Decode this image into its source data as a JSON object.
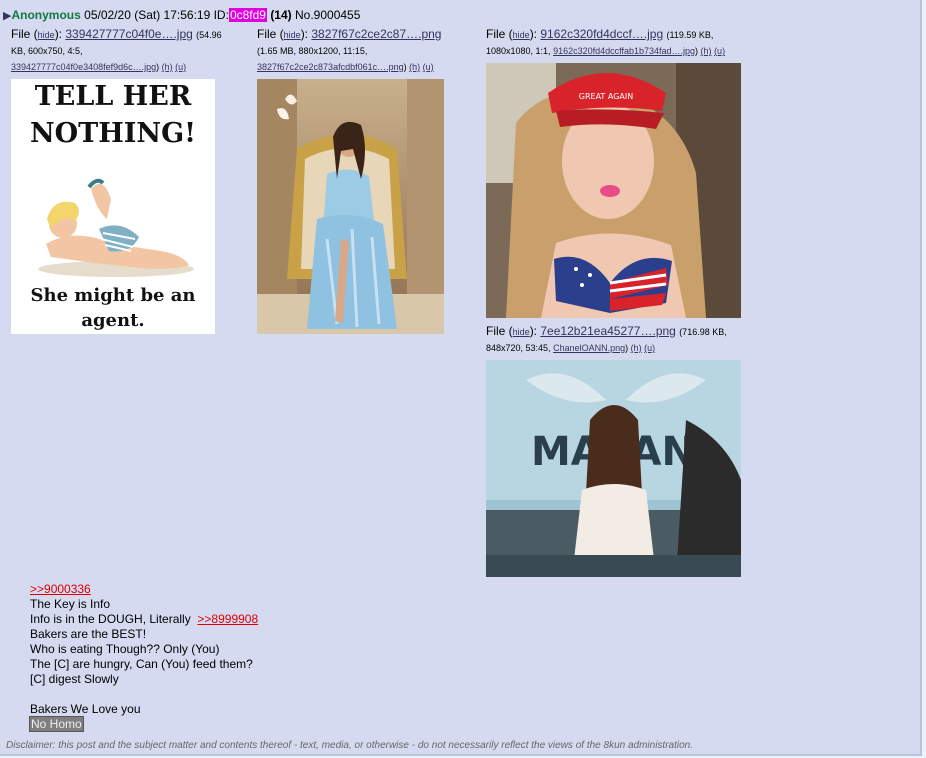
{
  "post": {
    "name": "Anonymous",
    "datetime": "05/02/20 (Sat) 17:56:19",
    "id_label": "ID:",
    "id": "0c8fd9",
    "id_count": "(14)",
    "number": "No.9000455"
  },
  "files": [
    {
      "prefix": "File (",
      "hide": "hide",
      "suffix": "):",
      "filename": "339427777c04f0e….jpg",
      "meta1": "(54.96",
      "meta2": "KB, 600x750, 4:5,",
      "original": "339427777c04f0e3408fef9d6c….jpg",
      "h": "(h)",
      "u": "(u)"
    },
    {
      "prefix": "File (",
      "hide": "hide",
      "suffix": "):",
      "filename": "3827f67c2ce2c87….png",
      "meta1": "",
      "meta2": "(1.65 MB, 880x1200, 11:15,",
      "original": "3827f67c2ce2c873afcdbf061c….png",
      "h": "(h)",
      "u": "(u)"
    },
    {
      "prefix": "File (",
      "hide": "hide",
      "suffix": "):",
      "filename": "9162c320fd4dccf….jpg",
      "meta1": "(119.59 KB,",
      "meta2": "1080x1080, 1:1,",
      "original": "9162c320fd4dccffab1b734fad….jpg",
      "h": "(h)",
      "u": "(u)"
    },
    {
      "prefix": "File (",
      "hide": "hide",
      "suffix": "):",
      "filename": "7ee12b21ea45277….png",
      "meta1": "(716.98 KB,",
      "meta2": "848x720, 53:45,",
      "original": "ChanelOANN.png",
      "h": "(h)",
      "u": "(u)"
    }
  ],
  "poster": {
    "headline1": "TELL HER",
    "headline2": "NOTHING!",
    "tagline1": "She might be an",
    "tagline2": "agent."
  },
  "cap_text": "GREAT AGAIN",
  "studio_text": "MA  IAN",
  "body": {
    "quote1": ">>9000336",
    "line1": "The Key is Info",
    "line2": "Info is in the DOUGH, Literally",
    "quote2": ">>8999908",
    "line3": "Bakers are the BEST!",
    "line4": "Who is eating Though?? Only (You)",
    "line5": "The [C] are hungry, Can (You) feed them?",
    "line6": "[C] digest Slowly",
    "line7": "Bakers We Love you",
    "spoiler": "No Homo"
  },
  "disclaimer": "Disclaimer: this post and the subject matter and contents thereof - text, media, or otherwise - do not necessarily reflect the views of the 8kun administration.",
  "colors": {
    "post_bg": "#d6daf0",
    "name_green": "#117743",
    "id_magenta": "#e000e0",
    "link": "#34345c",
    "quote_red": "#d00"
  }
}
